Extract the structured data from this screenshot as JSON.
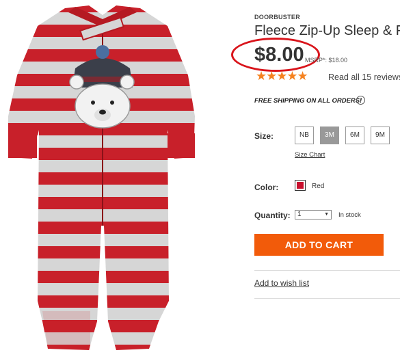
{
  "product": {
    "badge": "DOORBUSTER",
    "title": "Fleece Zip-Up Sleep & F",
    "price": "$8.00",
    "msrp": "MSRP*: $18.00",
    "rating_stars": 5,
    "stars_display": "★★★★★",
    "reviews_link": "Read all 15 reviews",
    "free_shipping": "FREE SHIPPING ON ALL ORDERS!",
    "info_icon": "i"
  },
  "size": {
    "label": "Size:",
    "options": [
      "NB",
      "3M",
      "6M",
      "9M"
    ],
    "selected": "3M",
    "chart_link": "Size Chart"
  },
  "color": {
    "label": "Color:",
    "swatch_hex": "#c8102e",
    "name": "Red"
  },
  "quantity": {
    "label": "Quantity:",
    "value": "1",
    "arrow": "▼",
    "stock": "In stock"
  },
  "actions": {
    "add_to_cart": "ADD TO CART",
    "wish_list": "Add to wish list"
  },
  "colors": {
    "accent_orange": "#f25b0a",
    "star_orange": "#f58220",
    "annotation_red": "#d9141b",
    "stripe_red": "#c8202a",
    "stripe_gray": "#d6d6d6"
  }
}
